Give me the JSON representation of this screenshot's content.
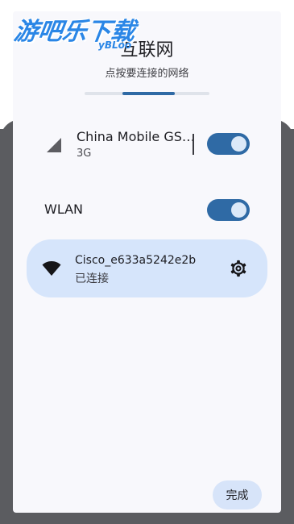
{
  "watermark": {
    "text": "游吧乐下载",
    "sub": "yBLoo"
  },
  "header": {
    "title": "互联网",
    "subtitle": "点按要连接的网络",
    "progress_fraction": 0.42
  },
  "mobile": {
    "name": "China Mobile GS…",
    "network_type": "3G",
    "enabled": true
  },
  "wlan": {
    "label": "WLAN",
    "enabled": true
  },
  "wifi": {
    "ssid": "Cisco_e633a5242e2b",
    "status": "已连接"
  },
  "footer": {
    "done_label": "完成"
  },
  "colors": {
    "accent": "#2f6aa5",
    "card": "#d6e5fb",
    "panel": "#f8f8fc",
    "dim_background": "#5b5c60"
  },
  "icons": [
    "signal-icon",
    "wifi-icon",
    "gear-icon"
  ]
}
